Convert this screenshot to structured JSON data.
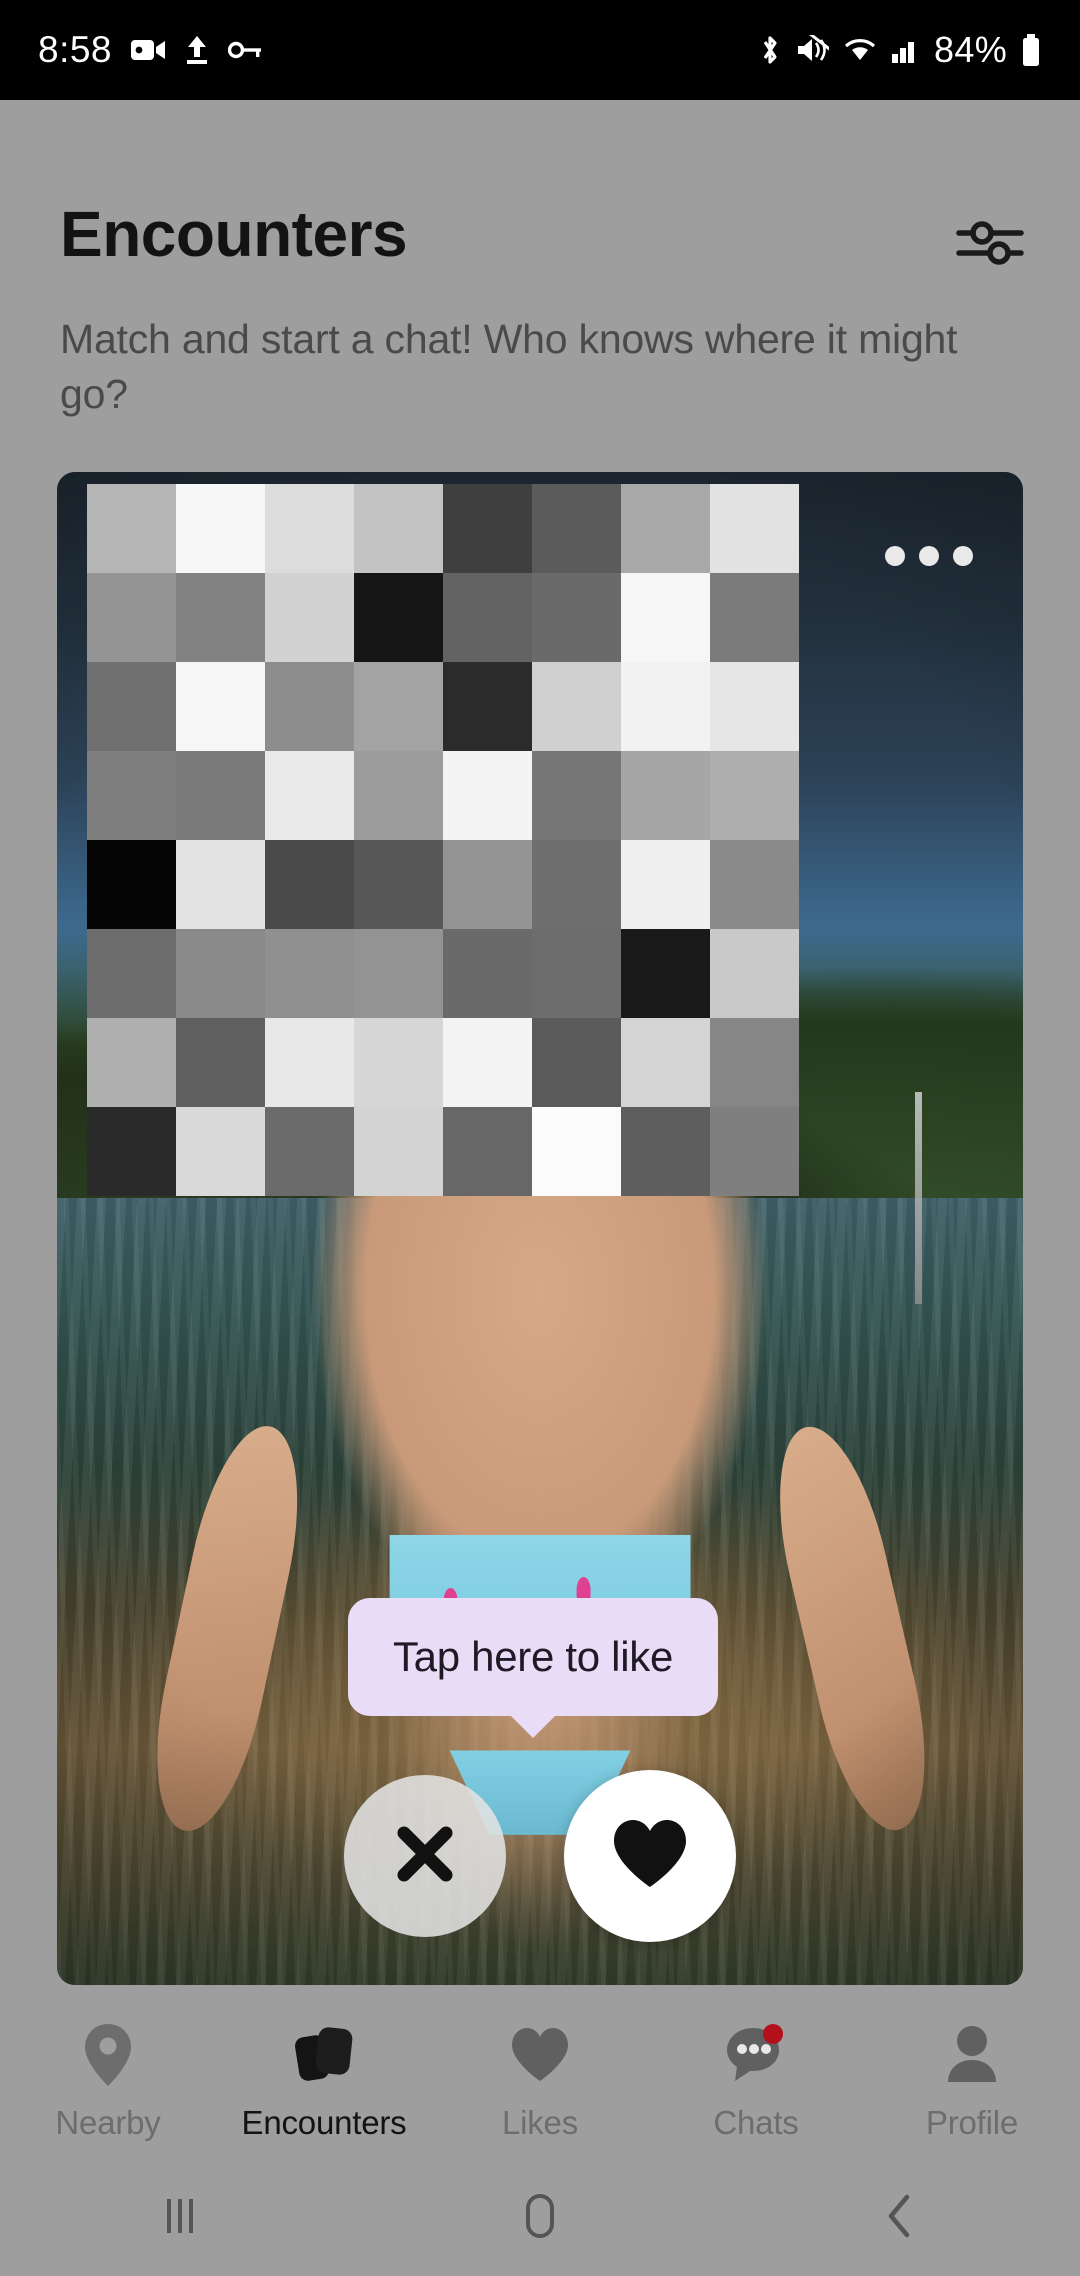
{
  "status_bar": {
    "time": "8:58",
    "battery_percent": "84%",
    "left_icons": [
      "video-camera-icon",
      "upload-arrow-icon",
      "vpn-key-icon"
    ],
    "right_icons": [
      "bluetooth-icon",
      "vibrate-mute-icon",
      "wifi-icon",
      "cellular-signal-icon",
      "battery-icon"
    ]
  },
  "header": {
    "title": "Encounters",
    "subtitle": "Match and start a chat! Who knows where it might go?",
    "filter_icon": "filter-sliders-icon"
  },
  "card": {
    "menu_icon": "more-options-icon",
    "photo_description": "person-in-blue-flamingo-bikini-standing-in-water",
    "censored_region": "pixelated-face-mosaic",
    "censor_grid": {
      "cols": 8,
      "rows": 8,
      "shades": [
        "#b5b5b5",
        "#f7f7f7",
        "#dcdcdc",
        "#c3c3c3",
        "#3f3f3f",
        "#5b5b5b",
        "#a8a8a8",
        "#e2e2e2",
        "#949494",
        "#828282",
        "#d2d2d2",
        "#161616",
        "#636363",
        "#6a6a6a",
        "#f6f6f6",
        "#7b7b7b",
        "#6f6f6f",
        "#f6f6f6",
        "#8d8d8d",
        "#a3a3a3",
        "#2b2b2b",
        "#d0d0d0",
        "#f2f2f2",
        "#e6e6e6",
        "#7e7e7e",
        "#7a7a7a",
        "#e9e9e9",
        "#9c9c9c",
        "#f4f4f4",
        "#767676",
        "#a6a6a6",
        "#aeaeae",
        "#050505",
        "#e3e3e3",
        "#4a4a4a",
        "#585858",
        "#949494",
        "#6e6e6e",
        "#efefef",
        "#8a8a8a",
        "#6c6c6c",
        "#8a8a8a",
        "#909090",
        "#939393",
        "#6a6a6a",
        "#6d6d6d",
        "#191919",
        "#c9c9c9",
        "#afafaf",
        "#5f5f5f",
        "#e8e8e8",
        "#d6d6d6",
        "#f3f3f3",
        "#5a5a5a",
        "#d4d4d4",
        "#868686",
        "#2a2a2a",
        "#d9d9d9",
        "#6b6b6b",
        "#d3d3d3",
        "#676767",
        "#fbfbfb",
        "#5e5e5e",
        "#7f7f7f"
      ]
    }
  },
  "tooltip": {
    "label": "Tap here to like",
    "background": "#e9dcf7"
  },
  "actions": {
    "dislike_label": "Dislike",
    "dislike_icon": "close-x-icon",
    "like_label": "Like",
    "like_icon": "heart-icon"
  },
  "bottom_nav": {
    "items": [
      {
        "label": "Nearby",
        "icon": "location-pin-icon",
        "active": false,
        "badge": false
      },
      {
        "label": "Encounters",
        "icon": "card-stack-icon",
        "active": true,
        "badge": false
      },
      {
        "label": "Likes",
        "icon": "heart-icon",
        "active": false,
        "badge": false
      },
      {
        "label": "Chats",
        "icon": "chat-bubble-icon",
        "active": false,
        "badge": true
      },
      {
        "label": "Profile",
        "icon": "person-icon",
        "active": false,
        "badge": false
      }
    ]
  },
  "android_nav": {
    "recents_icon": "recents-icon",
    "home_icon": "home-icon",
    "back_icon": "back-icon"
  },
  "colors": {
    "page_background": "#9e9e9e",
    "accent_tooltip": "#e9dcf7",
    "badge_red": "#b3101c",
    "active_nav": "#131313"
  }
}
